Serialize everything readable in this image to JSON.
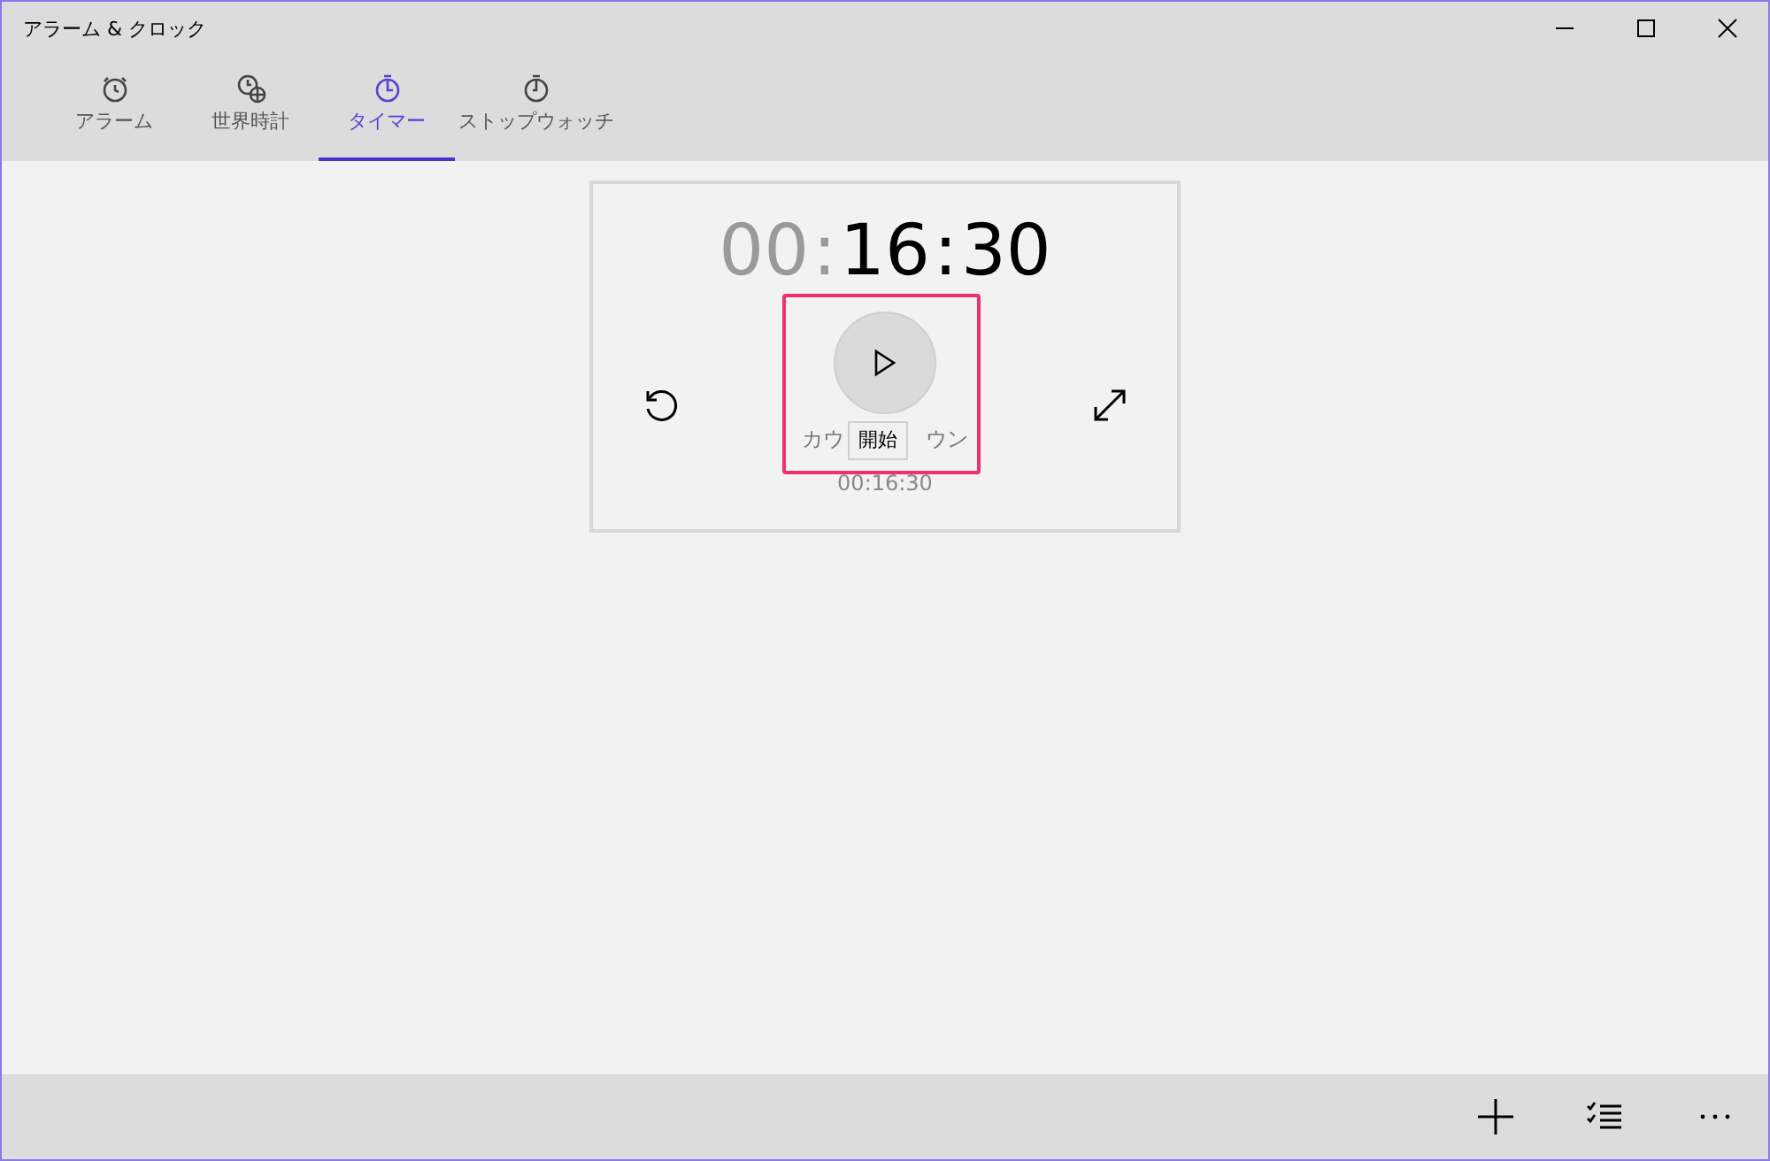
{
  "window": {
    "title": "アラーム & クロック"
  },
  "tabs": [
    {
      "label": "アラーム",
      "selected": false
    },
    {
      "label": "世界時計",
      "selected": false
    },
    {
      "label": "タイマー",
      "selected": true
    },
    {
      "label": "ストップウォッチ",
      "selected": false
    }
  ],
  "timer": {
    "segments": [
      {
        "text": "00",
        "active": false
      },
      {
        "text": ":",
        "active": false
      },
      {
        "text": "16",
        "active": true
      },
      {
        "text": ":",
        "active": true
      },
      {
        "text": "30",
        "active": true
      }
    ],
    "label_parts": [
      "カウ",
      "ウン"
    ],
    "original_time": "00:16:30",
    "tooltip": "開始",
    "highlighted": true
  }
}
